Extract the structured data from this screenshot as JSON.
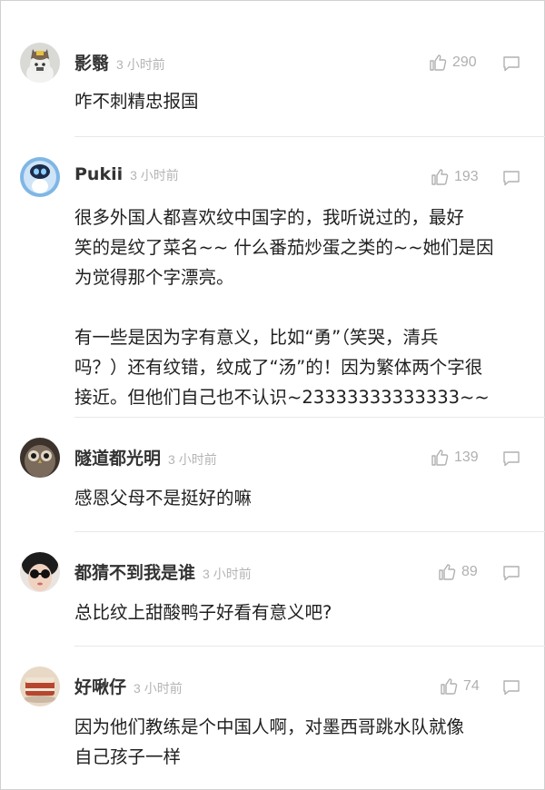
{
  "comments": [
    {
      "user": "影翳",
      "time": "3 小时前",
      "likes": "290",
      "avatar": "cat-avatar",
      "text": "咋不刺精忠报国"
    },
    {
      "user": "Pukii",
      "time": "3 小时前",
      "likes": "193",
      "avatar": "robot-avatar",
      "text": "很多外国人都喜欢纹中国字的，我听说过的，最好\n笑的是纹了菜名~~ 什么番茄炒蛋之类的~~她们是因\n为觉得那个字漂亮。\n\n有一些是因为字有意义，比如“勇”（笑哭，清兵\n吗？）还有纹错，纹成了“汤”的！因为繁体两个字很\n接近。但他们自己也不认识~23333333333333~~"
    },
    {
      "user": "隧道都光明",
      "time": "3 小时前",
      "likes": "139",
      "avatar": "owl-avatar",
      "text": "感恩父母不是挺好的嘛"
    },
    {
      "user": "都猜不到我是谁",
      "time": "3 小时前",
      "likes": "89",
      "avatar": "glasses-person-avatar",
      "text": "总比纹上甜酸鸭子好看有意义吧?"
    },
    {
      "user": "好啾仔",
      "time": "3 小时前",
      "likes": "74",
      "avatar": "food-avatar",
      "text": "因为他们教练是个中国人啊，对墨西哥跳水队就像\n自己孩子一样"
    }
  ]
}
